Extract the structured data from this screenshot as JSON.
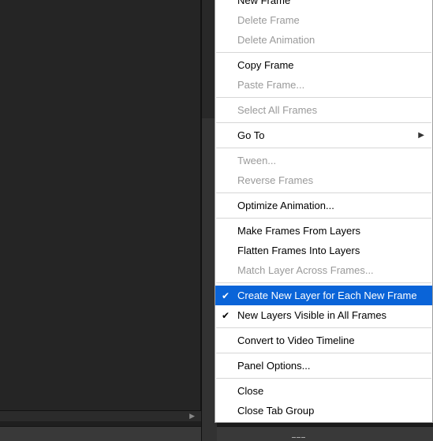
{
  "menu": {
    "items": [
      {
        "label": "New Frame",
        "enabled": true,
        "checked": false,
        "submenu": false
      },
      {
        "label": "Delete Frame",
        "enabled": false,
        "checked": false,
        "submenu": false
      },
      {
        "label": "Delete Animation",
        "enabled": false,
        "checked": false,
        "submenu": false
      },
      {
        "sep": true
      },
      {
        "label": "Copy Frame",
        "enabled": true,
        "checked": false,
        "submenu": false
      },
      {
        "label": "Paste Frame...",
        "enabled": false,
        "checked": false,
        "submenu": false
      },
      {
        "sep": true
      },
      {
        "label": "Select All Frames",
        "enabled": false,
        "checked": false,
        "submenu": false
      },
      {
        "sep": true
      },
      {
        "label": "Go To",
        "enabled": true,
        "checked": false,
        "submenu": true
      },
      {
        "sep": true
      },
      {
        "label": "Tween...",
        "enabled": false,
        "checked": false,
        "submenu": false
      },
      {
        "label": "Reverse Frames",
        "enabled": false,
        "checked": false,
        "submenu": false
      },
      {
        "sep": true
      },
      {
        "label": "Optimize Animation...",
        "enabled": true,
        "checked": false,
        "submenu": false
      },
      {
        "sep": true
      },
      {
        "label": "Make Frames From Layers",
        "enabled": true,
        "checked": false,
        "submenu": false
      },
      {
        "label": "Flatten Frames Into Layers",
        "enabled": true,
        "checked": false,
        "submenu": false
      },
      {
        "label": "Match Layer Across Frames...",
        "enabled": false,
        "checked": false,
        "submenu": false
      },
      {
        "sep": true
      },
      {
        "label": "Create New Layer for Each New Frame",
        "enabled": true,
        "checked": true,
        "submenu": false,
        "highlight": true
      },
      {
        "label": "New Layers Visible in All Frames",
        "enabled": true,
        "checked": true,
        "submenu": false
      },
      {
        "sep": true
      },
      {
        "label": "Convert to Video Timeline",
        "enabled": true,
        "checked": false,
        "submenu": false
      },
      {
        "sep": true
      },
      {
        "label": "Panel Options...",
        "enabled": true,
        "checked": false,
        "submenu": false
      },
      {
        "sep": true
      },
      {
        "label": "Close",
        "enabled": true,
        "checked": false,
        "submenu": false
      },
      {
        "label": "Close Tab Group",
        "enabled": true,
        "checked": false,
        "submenu": false
      }
    ]
  }
}
